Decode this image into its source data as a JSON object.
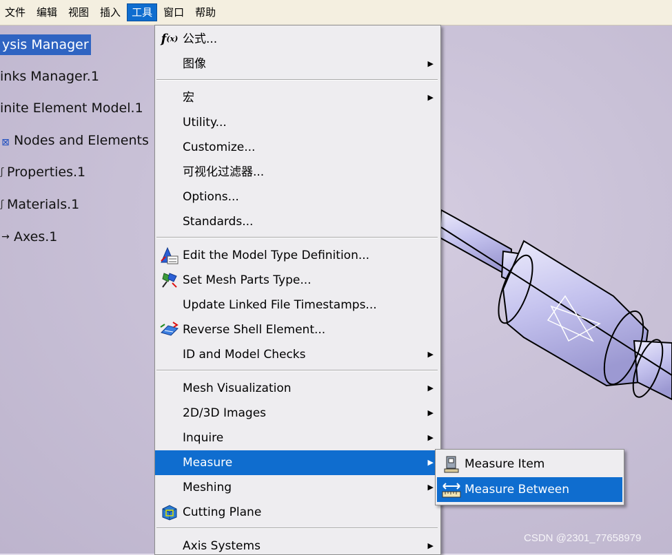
{
  "menubar": {
    "items": [
      {
        "label": "文件"
      },
      {
        "label": "编辑"
      },
      {
        "label": "视图"
      },
      {
        "label": "插入"
      },
      {
        "label": "工具",
        "active": true
      },
      {
        "label": "窗口"
      },
      {
        "label": "帮助"
      }
    ]
  },
  "tree": {
    "items": [
      {
        "label": "ysis Manager",
        "selected": true
      },
      {
        "label": "inks Manager.1"
      },
      {
        "label": "inite Element Model.1"
      },
      {
        "label": "Nodes and Elements",
        "icon": "nodes-elements-icon"
      },
      {
        "label": "Properties.1",
        "icon": "properties-icon"
      },
      {
        "label": "Materials.1",
        "icon": "materials-icon"
      },
      {
        "label": "Axes.1",
        "icon": "axes-arrow-icon"
      }
    ]
  },
  "tools_menu": {
    "items": [
      {
        "label": "公式...",
        "icon": "formula-icon"
      },
      {
        "label": "图像",
        "submenu": true
      },
      {
        "label": "宏",
        "submenu": true
      },
      {
        "label": "Utility..."
      },
      {
        "label": "Customize..."
      },
      {
        "label": "可视化过滤器..."
      },
      {
        "label": "Options..."
      },
      {
        "label": "Standards..."
      },
      {
        "label": "Edit the Model Type Definition...",
        "icon": "model-type-icon"
      },
      {
        "label": "Set Mesh Parts Type...",
        "icon": "mesh-parts-icon"
      },
      {
        "label": "Update Linked File Timestamps..."
      },
      {
        "label": "Reverse Shell Element...",
        "icon": "reverse-shell-icon"
      },
      {
        "label": "ID and Model Checks",
        "submenu": true
      },
      {
        "label": "Mesh Visualization",
        "submenu": true
      },
      {
        "label": "2D/3D Images",
        "submenu": true
      },
      {
        "label": "Inquire",
        "submenu": true
      },
      {
        "label": "Measure",
        "submenu": true,
        "highlighted": true
      },
      {
        "label": "Meshing",
        "submenu": true
      },
      {
        "label": "Cutting Plane",
        "icon": "cutting-plane-icon"
      },
      {
        "label": "Axis Systems",
        "submenu": true
      }
    ]
  },
  "measure_submenu": {
    "items": [
      {
        "label": "Measure Item",
        "icon": "measure-item-icon"
      },
      {
        "label": "Measure Between",
        "icon": "measure-between-icon",
        "highlighted": true
      }
    ]
  },
  "watermark": "CSDN @2301_77658979",
  "colors": {
    "highlight": "#0f6dcf",
    "menu_bg": "#eeedf0",
    "viewport_bg": "#c9c1d7",
    "model_fill": "#c3c3ee"
  }
}
